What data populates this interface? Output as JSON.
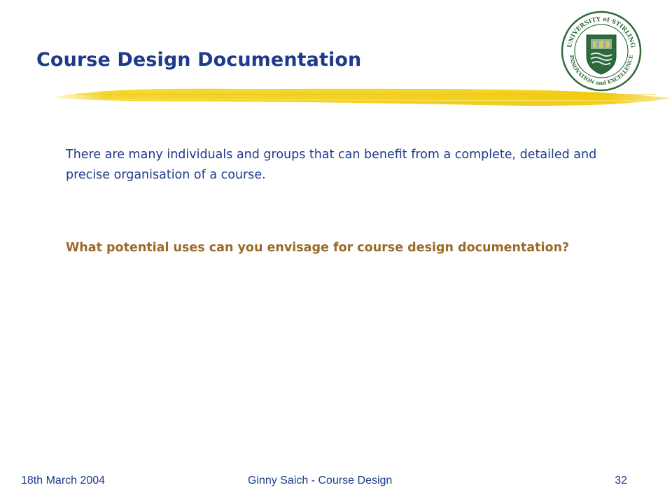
{
  "slide": {
    "title": "Course Design Documentation",
    "body_text": "There are many individuals and groups that can benefit from a complete, detailed and precise organisation of a course.",
    "question": "What potential uses can you envisage for course design documentation?"
  },
  "logo": {
    "text_top": "UNIVERSITY of STIRLING",
    "text_bottom": "INNOVATION and EXCELLENCE"
  },
  "footer": {
    "date": "18th March 2004",
    "center": "Ginny Saich - Course Design",
    "page_number": "32"
  },
  "colors": {
    "title": "#1e3a8a",
    "question": "#9a6a2a",
    "underline": "#f2d21b",
    "logo_green": "#2f6b3a"
  }
}
